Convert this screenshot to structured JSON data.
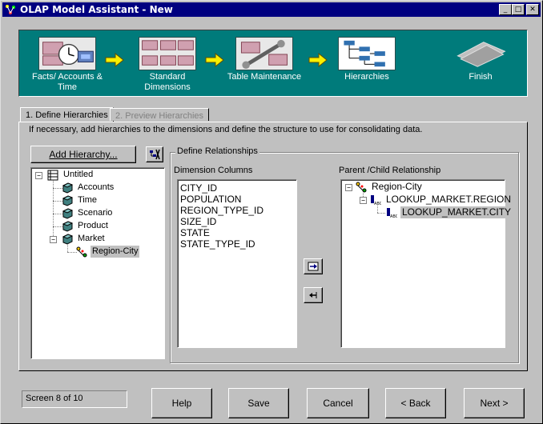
{
  "window": {
    "title": "OLAP Model Assistant - New",
    "minimize": "_",
    "maximize": "□",
    "close": "✕"
  },
  "steps": [
    {
      "label": "Facts/ Accounts & Time"
    },
    {
      "label": "Standard Dimensions"
    },
    {
      "label": "Table Maintenance"
    },
    {
      "label": "Hierarchies"
    },
    {
      "label": "Finish"
    }
  ],
  "tabs": [
    {
      "label": "1. Define Hierarchies"
    },
    {
      "label": "2. Preview Hierarchies"
    }
  ],
  "instruction": "If necessary, add hierarchies to the dimensions and define the structure to use for consolidating data.",
  "add_hierarchy_button": "Add Hierarchy...",
  "hierarchy_tree": {
    "root": "Untitled",
    "children": [
      "Accounts",
      "Time",
      "Scenario",
      "Product",
      "Market"
    ],
    "market_child": "Region-City"
  },
  "define_relationships": {
    "group_title": "Define Relationships",
    "dimension_columns_label": "Dimension Columns",
    "dimension_columns": [
      "CITY_ID",
      "POPULATION",
      "REGION_TYPE_ID",
      "SIZE_ID",
      "STATE",
      "STATE_TYPE_ID"
    ],
    "parent_child_label": "Parent /Child Relationship",
    "relationship_root": "Region-City",
    "relationship_level1": "LOOKUP_MARKET.REGION",
    "relationship_level2": "LOOKUP_MARKET.CITY"
  },
  "status": "Screen 8 of 10",
  "buttons": {
    "help": "Help",
    "save": "Save",
    "cancel": "Cancel",
    "back": "< Back",
    "next": "Next >"
  },
  "colors": {
    "banner": "#007b7b",
    "titlebar": "#000080",
    "arrow": "#f8f000"
  }
}
